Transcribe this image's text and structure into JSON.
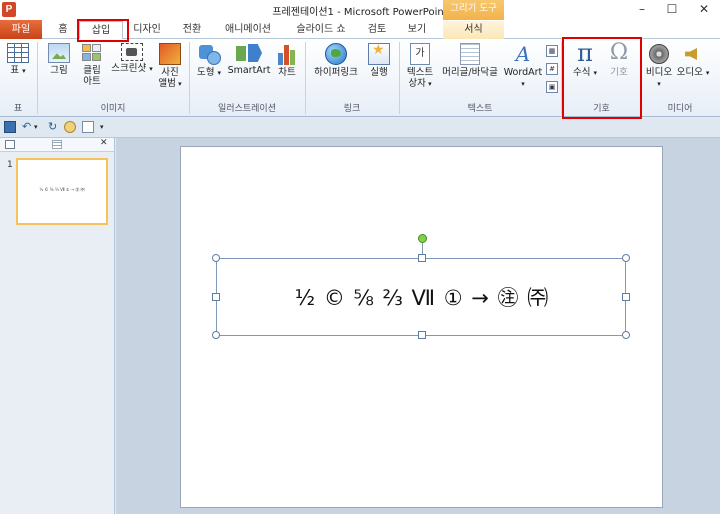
{
  "window": {
    "title": "프레젠테이션1 - Microsoft PowerPoint",
    "app_icon_letter": "P",
    "contextual_group": "그리기 도구",
    "minimize": "–",
    "maximize": "☐",
    "close": "✕"
  },
  "tabs": {
    "file": "파일",
    "home": "홈",
    "insert": "삽입",
    "design": "디자인",
    "transitions": "전환",
    "animations": "애니메이션",
    "slideshow": "슬라이드 쇼",
    "review": "검토",
    "view": "보기",
    "format": "서식"
  },
  "ribbon": {
    "groups": {
      "table": "표",
      "images": "이미지",
      "illustrations": "일러스트레이션",
      "links": "링크",
      "text": "텍스트",
      "symbols": "기호",
      "media": "미디어"
    },
    "buttons": {
      "table": "표",
      "picture": "그림",
      "clipart_line1": "클립",
      "clipart_line2": "아트",
      "screenshot": "스크린샷",
      "album_line1": "사진",
      "album_line2": "앨범",
      "shapes": "도형",
      "smartart": "SmartArt",
      "chart": "차트",
      "hyperlink": "하이퍼링크",
      "action": "실행",
      "textbox_line1": "텍스트",
      "textbox_line2": "상자",
      "header_footer": "머리글/바닥글",
      "wordart": "WordArt",
      "equation": "수식",
      "symbol": "기호",
      "video": "비디오",
      "audio": "오디오"
    },
    "icons": {
      "textbox_glyph": "가",
      "pi_glyph": "π",
      "omega_glyph": "Ω",
      "wordart_glyph": "A"
    }
  },
  "slides_panel": {
    "thumbnail_number": "1",
    "thumbnail_text": "½ © ⅝ ⅔ Ⅶ ① → ㊟ ㈜",
    "close": "✕"
  },
  "slide": {
    "textbox_content": "½ © ⅝ ⅔ Ⅶ ① → ㊟ ㈜"
  },
  "highlight_color": "#e00000"
}
